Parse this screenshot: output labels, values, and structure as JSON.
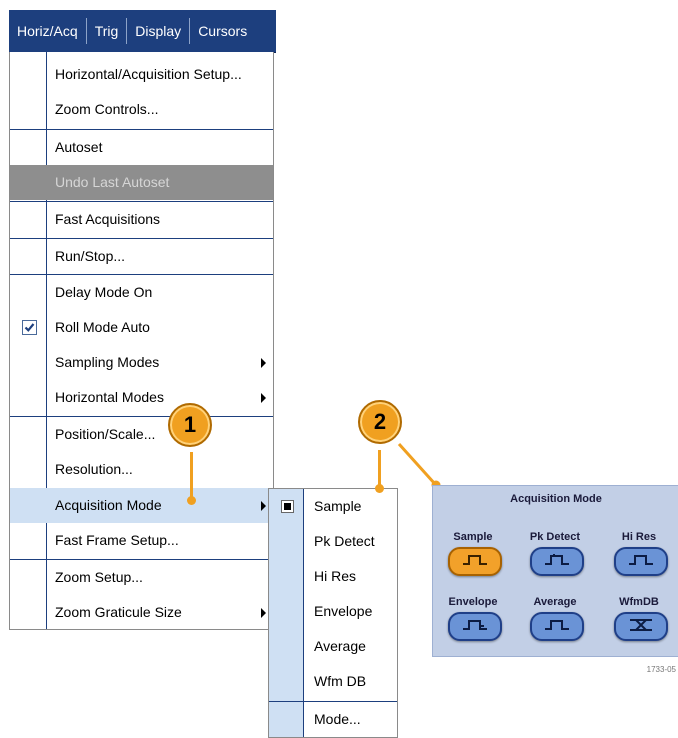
{
  "menubar": {
    "items": [
      "Horiz/Acq",
      "Trig",
      "Display",
      "Cursors"
    ]
  },
  "dropdown": {
    "items": {
      "horizontal_setup": "Horizontal/Acquisition Setup...",
      "zoom_controls": "Zoom Controls...",
      "autoset": "Autoset",
      "undo_autoset": "Undo Last Autoset",
      "fast_acquisitions": "Fast Acquisitions",
      "run_stop": "Run/Stop...",
      "delay_mode": "Delay Mode On",
      "roll_mode": "Roll Mode Auto",
      "sampling_modes": "Sampling Modes",
      "horizontal_modes": "Horizontal Modes",
      "position_scale": "Position/Scale...",
      "resolution": "Resolution...",
      "acquisition_mode": "Acquisition Mode",
      "fast_frame": "Fast Frame Setup...",
      "zoom_setup": "Zoom Setup...",
      "zoom_graticule": "Zoom Graticule Size"
    },
    "roll_mode_checked": true
  },
  "submenu": {
    "items": [
      "Sample",
      "Pk Detect",
      "Hi Res",
      "Envelope",
      "Average",
      "Wfm DB"
    ],
    "selected": "Sample",
    "mode": "Mode..."
  },
  "callouts": {
    "one": "1",
    "two": "2"
  },
  "acq_panel": {
    "title": "Acquisition Mode",
    "buttons": [
      "Sample",
      "Pk Detect",
      "Hi Res",
      "Envelope",
      "Average",
      "WfmDB"
    ],
    "active": "Sample"
  },
  "figure_id": "1733-05",
  "colors": {
    "menubar_bg": "#1d3f7e",
    "callout": "#f0a020",
    "highlight": "#cfe0f3",
    "panel_bg": "#c2cfe6"
  }
}
